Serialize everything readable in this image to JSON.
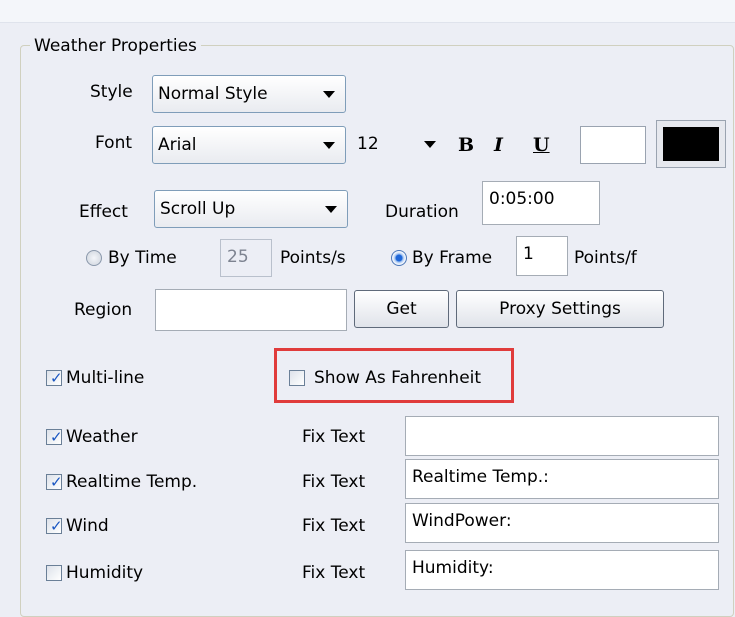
{
  "group": {
    "title": "Weather Properties"
  },
  "style": {
    "label": "Style",
    "value": "Normal Style"
  },
  "font": {
    "label": "Font",
    "family": "Arial",
    "size": "12",
    "bold": "B",
    "italic": "I",
    "underline": "U",
    "background_color": "#ffffff",
    "text_color": "#000000"
  },
  "effect": {
    "label": "Effect",
    "value": "Scroll Up"
  },
  "duration": {
    "label": "Duration",
    "value": "0:05:00"
  },
  "by_time": {
    "label": "By Time",
    "value": "25",
    "unit": "Points/s",
    "selected": false
  },
  "by_frame": {
    "label": "By Frame",
    "value": "1",
    "unit": "Points/f",
    "selected": true
  },
  "region": {
    "label": "Region",
    "value": "",
    "get_button": "Get",
    "proxy_button": "Proxy Settings"
  },
  "multiline": {
    "label": "Multi-line",
    "checked": true
  },
  "fahrenheit": {
    "label": "Show As Fahrenheit",
    "checked": false
  },
  "fields": [
    {
      "label": "Weather",
      "checked": true,
      "fix_label": "Fix Text",
      "fix_value": ""
    },
    {
      "label": "Realtime Temp.",
      "checked": true,
      "fix_label": "Fix Text",
      "fix_value": "Realtime Temp.:"
    },
    {
      "label": "Wind",
      "checked": true,
      "fix_label": "Fix Text",
      "fix_value": "WindPower:"
    },
    {
      "label": "Humidity",
      "checked": false,
      "fix_label": "Fix Text",
      "fix_value": "Humidity:"
    }
  ],
  "colors": {
    "highlight": "#e03b3b",
    "check": "#1b57c2"
  }
}
